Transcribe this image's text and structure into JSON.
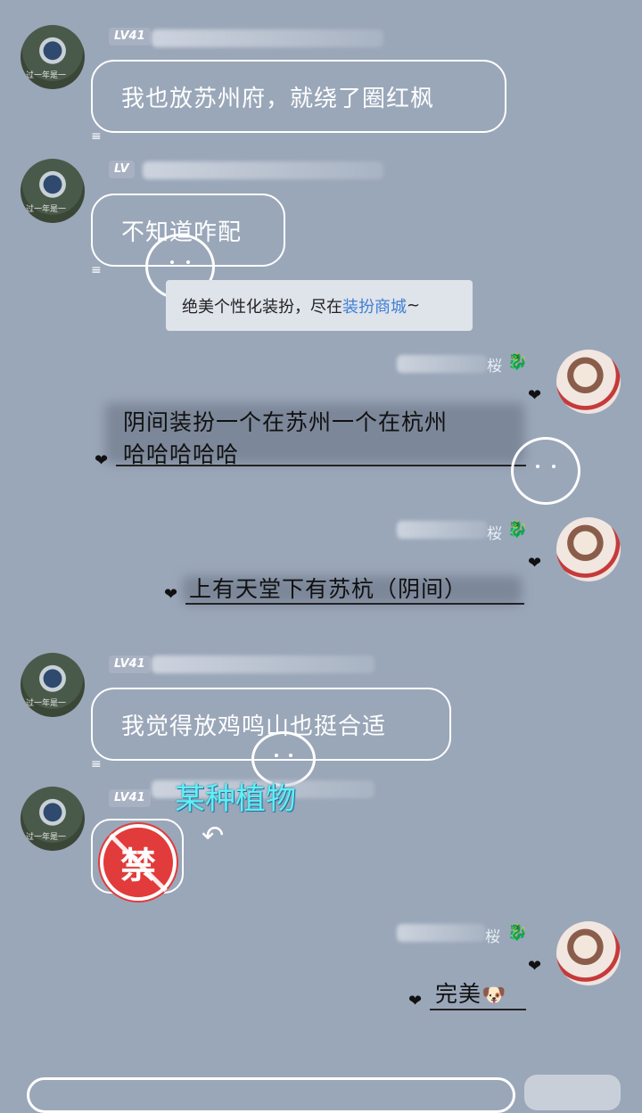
{
  "messages": {
    "m1": {
      "level": "LV41",
      "text": "我也放苏州府，就绕了圈红枫"
    },
    "m2": {
      "level": "LV",
      "text": "不知道咋配"
    },
    "tip": {
      "prefix": "绝美个性化装扮，尽在",
      "link": "装扮商城",
      "suffix": "~"
    },
    "m3": {
      "name_suffix": "桜",
      "line1": "阴间装扮一个在苏州一个在杭州",
      "line2": "哈哈哈哈哈"
    },
    "m4": {
      "name_suffix": "桜",
      "text": "上有天堂下有苏杭（阴间）"
    },
    "m5": {
      "level": "LV41",
      "text": "我觉得放鸡鸣山也挺合适"
    },
    "m6": {
      "level": "LV41",
      "annotation": "某种植物",
      "sticker_text": "禁"
    },
    "m7": {
      "name_suffix": "桜",
      "text": "完美",
      "emoji": "🐶"
    }
  },
  "avatar_caption": "过一年是一",
  "icons": {
    "badge": "dragon-badge-icon",
    "heart": "heart-icon",
    "ban": "ban-sticker-icon"
  },
  "colors": {
    "background": "#9aa7b9",
    "bubble_border": "#ffffff",
    "link": "#3f7fd6",
    "annotation": "#5ff0f5",
    "ban_red": "#e23b3b"
  }
}
